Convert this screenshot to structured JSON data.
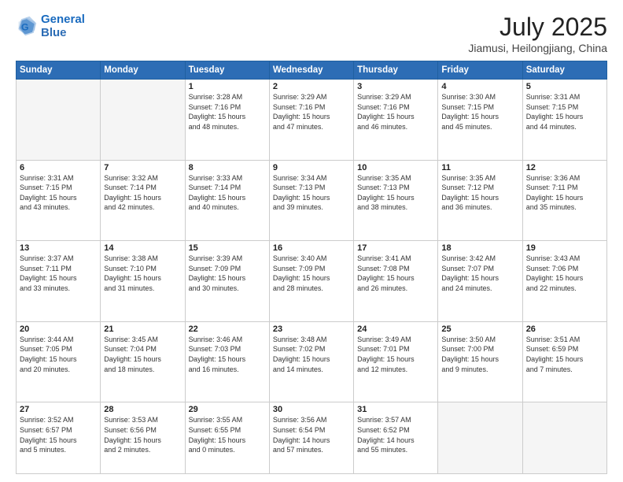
{
  "logo": {
    "line1": "General",
    "line2": "Blue"
  },
  "title": "July 2025",
  "subtitle": "Jiamusi, Heilongjiang, China",
  "header_days": [
    "Sunday",
    "Monday",
    "Tuesday",
    "Wednesday",
    "Thursday",
    "Friday",
    "Saturday"
  ],
  "weeks": [
    [
      {
        "day": "",
        "info": ""
      },
      {
        "day": "",
        "info": ""
      },
      {
        "day": "1",
        "info": "Sunrise: 3:28 AM\nSunset: 7:16 PM\nDaylight: 15 hours\nand 48 minutes."
      },
      {
        "day": "2",
        "info": "Sunrise: 3:29 AM\nSunset: 7:16 PM\nDaylight: 15 hours\nand 47 minutes."
      },
      {
        "day": "3",
        "info": "Sunrise: 3:29 AM\nSunset: 7:16 PM\nDaylight: 15 hours\nand 46 minutes."
      },
      {
        "day": "4",
        "info": "Sunrise: 3:30 AM\nSunset: 7:15 PM\nDaylight: 15 hours\nand 45 minutes."
      },
      {
        "day": "5",
        "info": "Sunrise: 3:31 AM\nSunset: 7:15 PM\nDaylight: 15 hours\nand 44 minutes."
      }
    ],
    [
      {
        "day": "6",
        "info": "Sunrise: 3:31 AM\nSunset: 7:15 PM\nDaylight: 15 hours\nand 43 minutes."
      },
      {
        "day": "7",
        "info": "Sunrise: 3:32 AM\nSunset: 7:14 PM\nDaylight: 15 hours\nand 42 minutes."
      },
      {
        "day": "8",
        "info": "Sunrise: 3:33 AM\nSunset: 7:14 PM\nDaylight: 15 hours\nand 40 minutes."
      },
      {
        "day": "9",
        "info": "Sunrise: 3:34 AM\nSunset: 7:13 PM\nDaylight: 15 hours\nand 39 minutes."
      },
      {
        "day": "10",
        "info": "Sunrise: 3:35 AM\nSunset: 7:13 PM\nDaylight: 15 hours\nand 38 minutes."
      },
      {
        "day": "11",
        "info": "Sunrise: 3:35 AM\nSunset: 7:12 PM\nDaylight: 15 hours\nand 36 minutes."
      },
      {
        "day": "12",
        "info": "Sunrise: 3:36 AM\nSunset: 7:11 PM\nDaylight: 15 hours\nand 35 minutes."
      }
    ],
    [
      {
        "day": "13",
        "info": "Sunrise: 3:37 AM\nSunset: 7:11 PM\nDaylight: 15 hours\nand 33 minutes."
      },
      {
        "day": "14",
        "info": "Sunrise: 3:38 AM\nSunset: 7:10 PM\nDaylight: 15 hours\nand 31 minutes."
      },
      {
        "day": "15",
        "info": "Sunrise: 3:39 AM\nSunset: 7:09 PM\nDaylight: 15 hours\nand 30 minutes."
      },
      {
        "day": "16",
        "info": "Sunrise: 3:40 AM\nSunset: 7:09 PM\nDaylight: 15 hours\nand 28 minutes."
      },
      {
        "day": "17",
        "info": "Sunrise: 3:41 AM\nSunset: 7:08 PM\nDaylight: 15 hours\nand 26 minutes."
      },
      {
        "day": "18",
        "info": "Sunrise: 3:42 AM\nSunset: 7:07 PM\nDaylight: 15 hours\nand 24 minutes."
      },
      {
        "day": "19",
        "info": "Sunrise: 3:43 AM\nSunset: 7:06 PM\nDaylight: 15 hours\nand 22 minutes."
      }
    ],
    [
      {
        "day": "20",
        "info": "Sunrise: 3:44 AM\nSunset: 7:05 PM\nDaylight: 15 hours\nand 20 minutes."
      },
      {
        "day": "21",
        "info": "Sunrise: 3:45 AM\nSunset: 7:04 PM\nDaylight: 15 hours\nand 18 minutes."
      },
      {
        "day": "22",
        "info": "Sunrise: 3:46 AM\nSunset: 7:03 PM\nDaylight: 15 hours\nand 16 minutes."
      },
      {
        "day": "23",
        "info": "Sunrise: 3:48 AM\nSunset: 7:02 PM\nDaylight: 15 hours\nand 14 minutes."
      },
      {
        "day": "24",
        "info": "Sunrise: 3:49 AM\nSunset: 7:01 PM\nDaylight: 15 hours\nand 12 minutes."
      },
      {
        "day": "25",
        "info": "Sunrise: 3:50 AM\nSunset: 7:00 PM\nDaylight: 15 hours\nand 9 minutes."
      },
      {
        "day": "26",
        "info": "Sunrise: 3:51 AM\nSunset: 6:59 PM\nDaylight: 15 hours\nand 7 minutes."
      }
    ],
    [
      {
        "day": "27",
        "info": "Sunrise: 3:52 AM\nSunset: 6:57 PM\nDaylight: 15 hours\nand 5 minutes."
      },
      {
        "day": "28",
        "info": "Sunrise: 3:53 AM\nSunset: 6:56 PM\nDaylight: 15 hours\nand 2 minutes."
      },
      {
        "day": "29",
        "info": "Sunrise: 3:55 AM\nSunset: 6:55 PM\nDaylight: 15 hours\nand 0 minutes."
      },
      {
        "day": "30",
        "info": "Sunrise: 3:56 AM\nSunset: 6:54 PM\nDaylight: 14 hours\nand 57 minutes."
      },
      {
        "day": "31",
        "info": "Sunrise: 3:57 AM\nSunset: 6:52 PM\nDaylight: 14 hours\nand 55 minutes."
      },
      {
        "day": "",
        "info": ""
      },
      {
        "day": "",
        "info": ""
      }
    ]
  ]
}
